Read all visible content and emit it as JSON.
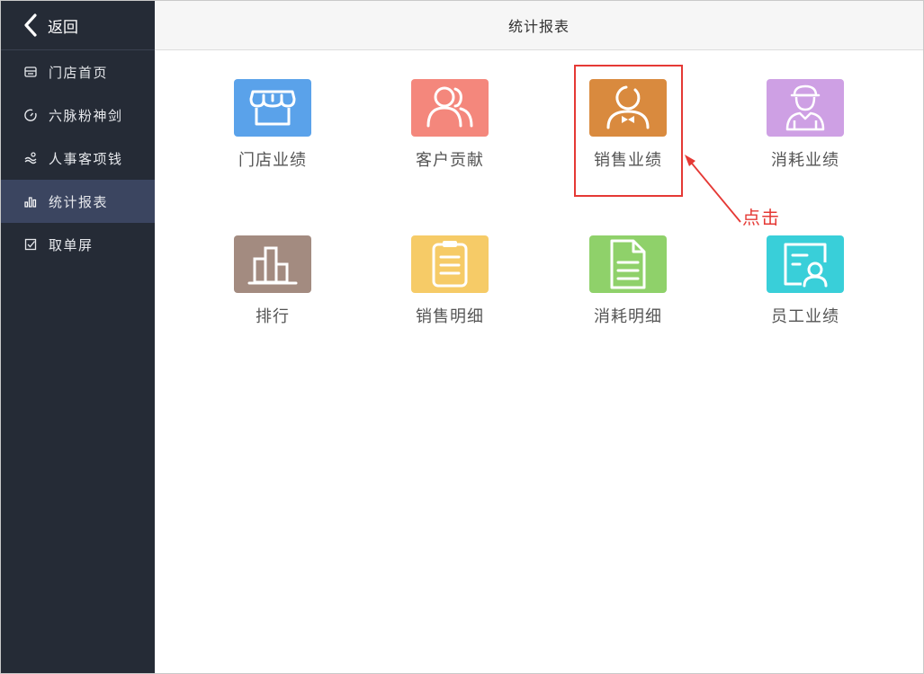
{
  "back": {
    "label": "返回"
  },
  "sidebar": {
    "items": [
      {
        "label": "门店首页",
        "icon": "store-icon",
        "active": false
      },
      {
        "label": "六脉粉神剑",
        "icon": "gauge-icon",
        "active": false
      },
      {
        "label": "人事客项钱",
        "icon": "coins-icon",
        "active": false
      },
      {
        "label": "统计报表",
        "icon": "bar-chart-icon",
        "active": true
      },
      {
        "label": "取单屏",
        "icon": "checkbox-icon",
        "active": false
      }
    ]
  },
  "header": {
    "title": "统计报表"
  },
  "tiles": [
    {
      "label": "门店业绩",
      "icon": "storefront-icon",
      "color": "#5aa2ea"
    },
    {
      "label": "客户贡献",
      "icon": "customers-icon",
      "color": "#f4877c"
    },
    {
      "label": "销售业绩",
      "icon": "salesperson-icon",
      "color": "#d98a3e"
    },
    {
      "label": "消耗业绩",
      "icon": "worker-icon",
      "color": "#cea0e4"
    },
    {
      "label": "排行",
      "icon": "ranking-icon",
      "color": "#a38b80"
    },
    {
      "label": "销售明细",
      "icon": "clipboard-icon",
      "color": "#f6cb67"
    },
    {
      "label": "消耗明细",
      "icon": "document-icon",
      "color": "#8fd16a"
    },
    {
      "label": "员工业绩",
      "icon": "employee-card-icon",
      "color": "#39cfd9"
    }
  ],
  "annotation": {
    "text": "点击",
    "color": "#e53935"
  }
}
